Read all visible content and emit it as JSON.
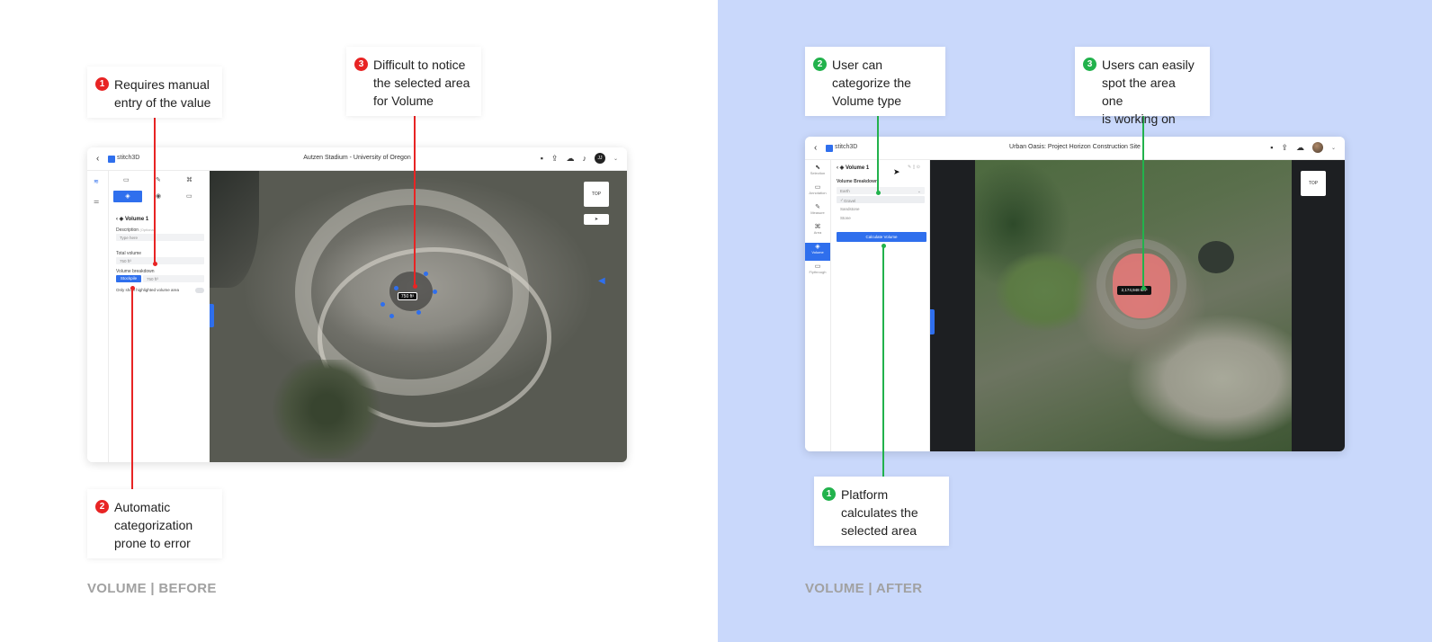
{
  "before": {
    "caption": "VOLUME | BEFORE",
    "app": {
      "brand": "stitch3D",
      "title": "Autzen Stadium - University of Oregon",
      "avatar_initials": "JJ",
      "panel": {
        "volume_title": "Volume 1",
        "description_label": "Description",
        "description_optional": "(Optional)",
        "description_placeholder": "Type here",
        "total_volume_label": "Total volume",
        "total_volume_value": "750 ft³",
        "breakdown_label": "Volume breakdown",
        "breakdown_tag": "Stockpile",
        "breakdown_value": "750 ft³",
        "toggle_label": "Only show highlighted volume area"
      },
      "map": {
        "view_label": "TOP",
        "measure_label": "750 ft³"
      }
    },
    "callouts": [
      {
        "number": "1",
        "text": "Requires manual\nentry of the value"
      },
      {
        "number": "3",
        "text": "Difficult to notice\nthe selected area\nfor Volume"
      },
      {
        "number": "2",
        "text": "Automatic\ncategorization\nprone to error"
      }
    ]
  },
  "after": {
    "caption": "VOLUME | AFTER",
    "app": {
      "brand": "stitch3D",
      "title": "Urban Oasis: Project Horizon Construction Site",
      "rail": [
        "Selection",
        "Annotation",
        "Measure",
        "Area",
        "Volume",
        "Flythrough"
      ],
      "panel": {
        "volume_title": "Volume 1",
        "breakdown_label": "Volume Breakdown",
        "dropdown_value": "Earth",
        "options": [
          "Gravel",
          "Sandstone",
          "Stone"
        ],
        "calc_button": "Calculate Volume"
      },
      "map": {
        "view_label": "TOP",
        "measure_label": "2,174,948 km³"
      }
    },
    "callouts": [
      {
        "number": "2",
        "text": "User can\ncategorize the\nVolume type"
      },
      {
        "number": "3",
        "text": "Users can easily\nspot the area one\nis working on"
      },
      {
        "number": "1",
        "text": "Platform\ncalculates the\nselected area"
      }
    ]
  },
  "colors": {
    "accent": "#2f6fed",
    "callout_red": "#e82424",
    "callout_green": "#22b24c",
    "after_background": "#c9d8fb"
  }
}
